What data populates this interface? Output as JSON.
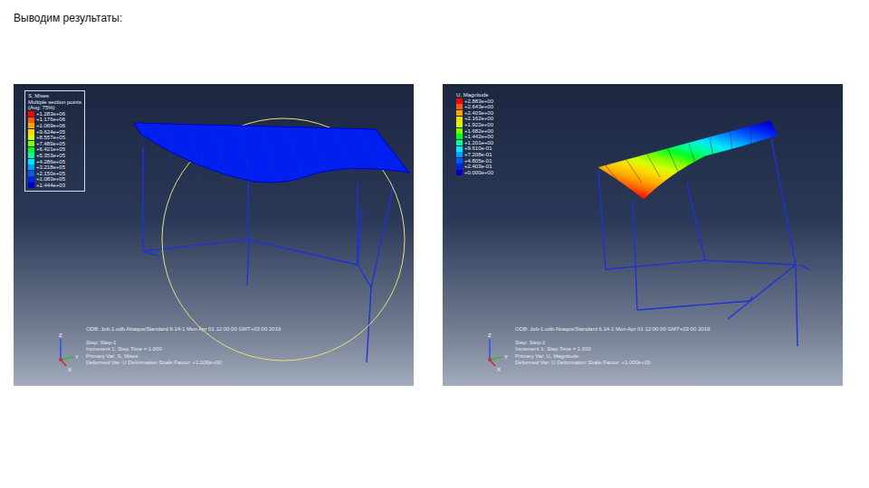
{
  "slide": {
    "title": "Выводим результаты:"
  },
  "viewports": [
    {
      "legend": {
        "framed": true,
        "title": "S, Mises",
        "lines": [
          "Multiple section points",
          "(Avg: 75%)"
        ],
        "entries": [
          {
            "value": "+1.283e+06",
            "color": "#ff0000"
          },
          {
            "value": "+1.176e+06",
            "color": "#ff5a00"
          },
          {
            "value": "+1.069e+06",
            "color": "#ffa500"
          },
          {
            "value": "+9.624e+05",
            "color": "#ffd700"
          },
          {
            "value": "+8.557e+05",
            "color": "#d4ff00"
          },
          {
            "value": "+7.489e+05",
            "color": "#7bff00"
          },
          {
            "value": "+6.421e+05",
            "color": "#00ff22"
          },
          {
            "value": "+5.353e+05",
            "color": "#00ff9a"
          },
          {
            "value": "+4.286e+05",
            "color": "#00e8ff"
          },
          {
            "value": "+3.218e+05",
            "color": "#00a2ff"
          },
          {
            "value": "+2.150e+05",
            "color": "#0059ff"
          },
          {
            "value": "+1.083e+05",
            "color": "#0020f0"
          },
          {
            "value": "+1.444e+03",
            "color": "#0000c8"
          }
        ]
      },
      "info": {
        "first": "ODB: Job-1.odb    Abaqus/Standard 6.14-1    Mon Apr 01 12:00:00 GMT+03:00 2019",
        "lines": [
          "Step: Step-1",
          "Increment    1: Step Time =    1.000",
          "Primary Var: S, Mises",
          "Deformed Var: U   Deformation Scale Factor: +1.000e+00"
        ]
      },
      "plot": {
        "kind": "stress"
      },
      "triad": [
        "Z",
        "Y",
        "X"
      ]
    },
    {
      "legend": {
        "framed": false,
        "title": "U, Magnitude",
        "lines": [],
        "entries": [
          {
            "value": "+2.883e+00",
            "color": "#ff0000"
          },
          {
            "value": "+2.643e+00",
            "color": "#ff5a00"
          },
          {
            "value": "+2.403e+00",
            "color": "#ffa500"
          },
          {
            "value": "+2.162e+00",
            "color": "#ffd700"
          },
          {
            "value": "+1.922e+00",
            "color": "#d4ff00"
          },
          {
            "value": "+1.682e+00",
            "color": "#7bff00"
          },
          {
            "value": "+1.442e+00",
            "color": "#00ff22"
          },
          {
            "value": "+1.201e+00",
            "color": "#00ff9a"
          },
          {
            "value": "+9.610e-01",
            "color": "#00e8ff"
          },
          {
            "value": "+7.208e-01",
            "color": "#00a2ff"
          },
          {
            "value": "+4.805e-01",
            "color": "#0059ff"
          },
          {
            "value": "+2.403e-01",
            "color": "#0020f0"
          },
          {
            "value": "+0.000e+00",
            "color": "#0000c8"
          }
        ]
      },
      "info": {
        "first": "ODB: Job-1.odb    Abaqus/Standard 6.14-1    Mon Apr 01 12:00:00 GMT+03:00 2019",
        "lines": [
          "Step: Step-1",
          "Increment    1: Step Time =    1.000",
          "Primary Var: U, Magnitude",
          "Deformed Var: U   Deformation Scale Factor: +1.000e+00"
        ]
      },
      "plot": {
        "kind": "displacement"
      },
      "triad": [
        "Z",
        "Y",
        "X"
      ]
    }
  ]
}
